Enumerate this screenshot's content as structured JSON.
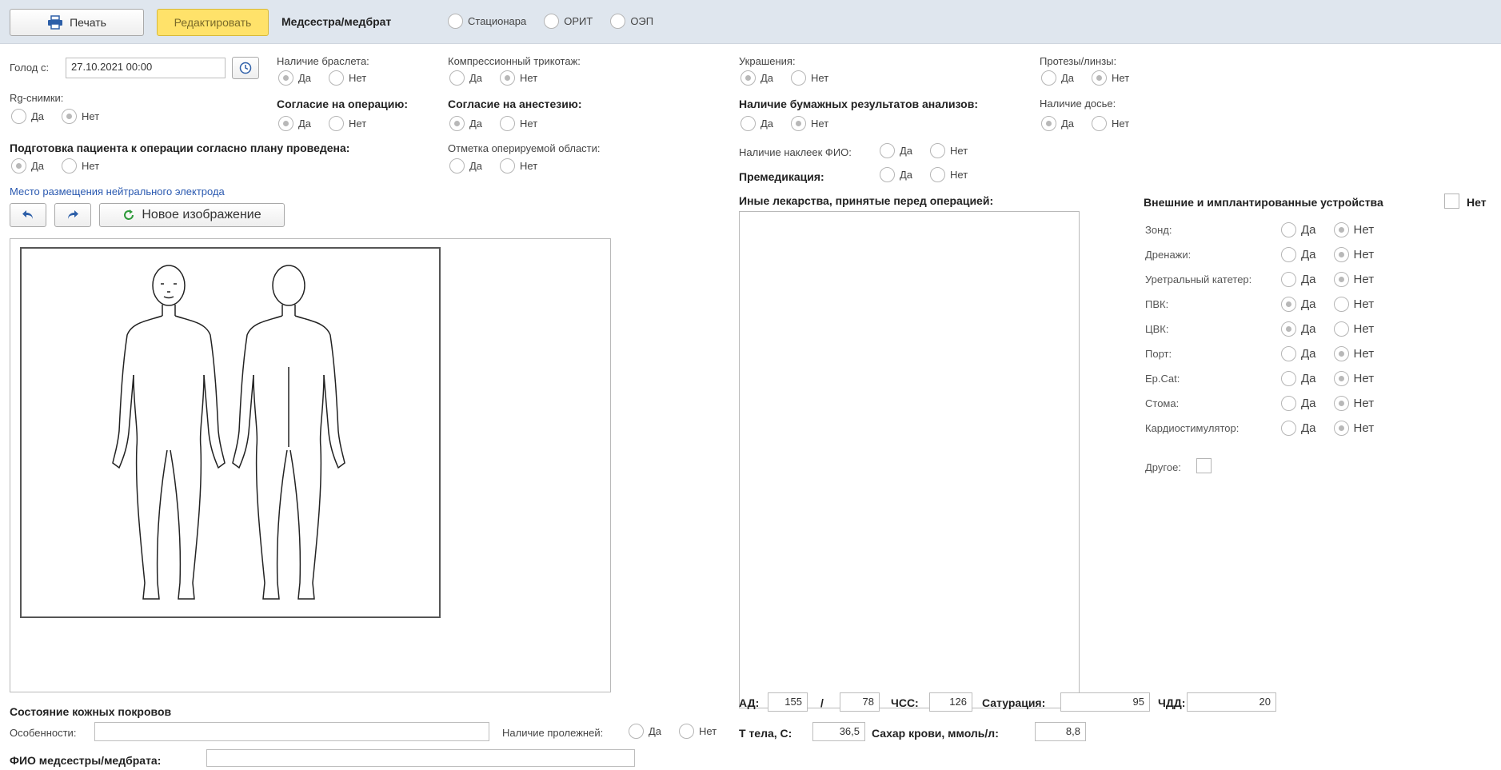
{
  "toolbar": {
    "print_label": "Печать",
    "edit_label": "Редактировать",
    "role_label": "Медсестра/медбрат",
    "role_options": [
      "Стационара",
      "ОРИТ",
      "ОЭП"
    ]
  },
  "fasting": {
    "label": "Голод с:",
    "value": "27.10.2021 00:00"
  },
  "bracelet": {
    "label": "Наличие браслета:",
    "yes": "Да",
    "no": "Нет"
  },
  "compression": {
    "label": "Компрессионный трикотаж:",
    "yes": "Да",
    "no": "Нет"
  },
  "jewelry": {
    "label": "Украшения:",
    "yes": "Да",
    "no": "Нет"
  },
  "prosthesis": {
    "label": "Протезы/линзы:",
    "yes": "Да",
    "no": "Нет"
  },
  "xray": {
    "label": "Rg-снимки:",
    "yes": "Да",
    "no": "Нет"
  },
  "surgery_consent": {
    "label": "Согласие на операцию:",
    "yes": "Да",
    "no": "Нет"
  },
  "anesthesia_consent": {
    "label": "Согласие на анестезию:",
    "yes": "Да",
    "no": "Нет"
  },
  "paper_results": {
    "label": "Наличие бумажных результатов анализов:",
    "yes": "Да",
    "no": "Нет"
  },
  "dossier": {
    "label": "Наличие досье:",
    "yes": "Да",
    "no": "Нет"
  },
  "preparation": {
    "label": "Подготовка пациента к операции согласно плану проведена:",
    "yes": "Да",
    "no": "Нет"
  },
  "area_mark": {
    "label": "Отметка оперируемой области:",
    "yes": "Да",
    "no": "Нет"
  },
  "name_stickers": {
    "label": "Наличие наклеек ФИО:",
    "yes": "Да",
    "no": "Нет"
  },
  "premedication": {
    "label": "Премедикация:",
    "yes": "Да",
    "no": "Нет"
  },
  "electrode": {
    "label": "Место размещения нейтрального электрода",
    "new_image_label": "Новое изображение"
  },
  "other_drugs": {
    "label": "Иные лекарства, принятые перед операцией:"
  },
  "devices": {
    "title": "Внешние и имплантированные устройства",
    "none_label": "Нет",
    "yes": "Да",
    "no": "Нет",
    "items": [
      {
        "label": "Зонд:",
        "value": "Нет"
      },
      {
        "label": "Дренажи:",
        "value": "Нет"
      },
      {
        "label": "Уретральный катетер:",
        "value": "Нет"
      },
      {
        "label": "ПВК:",
        "value": "Да"
      },
      {
        "label": "ЦВК:",
        "value": "Да"
      },
      {
        "label": "Порт:",
        "value": "Нет"
      },
      {
        "label": "Ep.Cat:",
        "value": "Нет"
      },
      {
        "label": "Стома:",
        "value": "Нет"
      },
      {
        "label": "Кардиостимулятор:",
        "value": "Нет"
      }
    ],
    "other_label": "Другое:"
  },
  "vitals": {
    "bp_label": "АД:",
    "bp_sys": "155",
    "bp_sep": "/",
    "bp_dia": "78",
    "hr_label": "ЧСС:",
    "hr": "126",
    "sat_label": "Сатурация:",
    "sat": "95",
    "rr_label": "ЧДД:",
    "rr": "20",
    "temp_label": "Т тела, С:",
    "temp": "36,5",
    "sugar_label": "Сахар крови, ммоль/л:",
    "sugar": "8,8"
  },
  "skin": {
    "title": "Состояние кожных покровов",
    "features_label": "Особенности:",
    "bedsores_label": "Наличие пролежней:",
    "yes": "Да",
    "no": "Нет"
  },
  "nurse": {
    "label": "ФИО медсестры/медбрата:"
  }
}
